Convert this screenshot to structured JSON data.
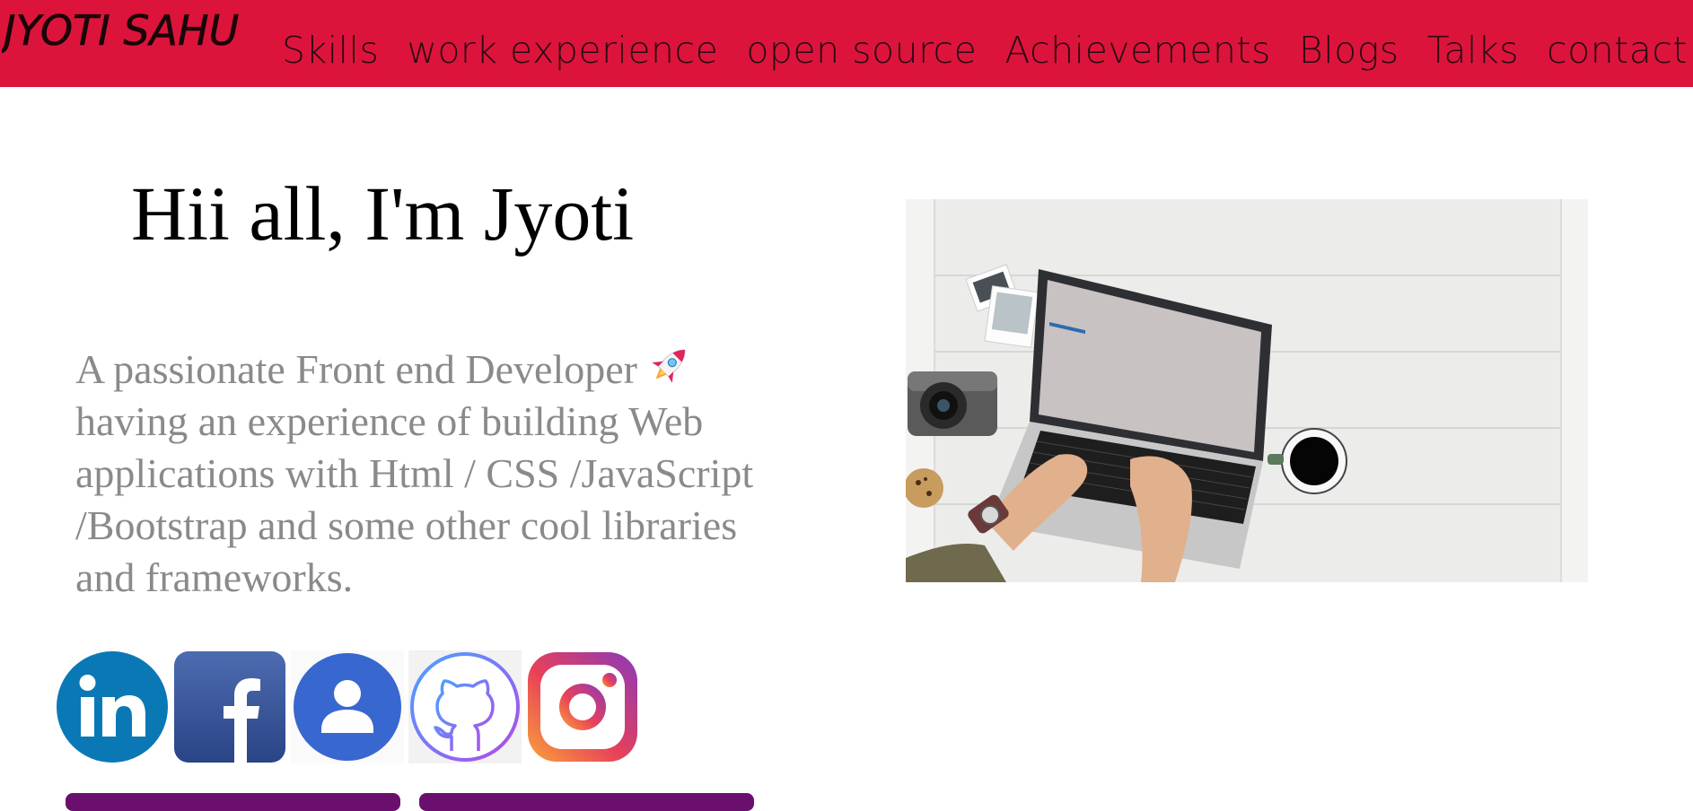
{
  "header": {
    "logo_text": "JYOTI SAHU",
    "brand_color": "#dc143c",
    "nav": [
      {
        "label": "Skills"
      },
      {
        "label": "work experience"
      },
      {
        "label": "open source"
      },
      {
        "label": "Achievements"
      },
      {
        "label": "Blogs"
      },
      {
        "label": "Talks"
      },
      {
        "label": "contact me"
      }
    ]
  },
  "hero": {
    "greeting": "Hii all, I'm Jyoti",
    "intro": "A passionate Front end Developer having an experience of building Web applications with Html / CSS /JavaScript /Bootstrap and some other cool libraries and frameworks.",
    "intro_lines": [
      "A passionate Front end Developer",
      "having an experience of building Web",
      "applications with Html / CSS /JavaScript",
      "/Bootstrap and some other cool libraries",
      "and frameworks."
    ],
    "emoji_icon": "rocket-icon",
    "image_icon": "laptop-desk-photo"
  },
  "social": [
    {
      "icon": "linkedin-icon"
    },
    {
      "icon": "facebook-icon"
    },
    {
      "icon": "profile-icon"
    },
    {
      "icon": "github-icon"
    },
    {
      "icon": "instagram-icon"
    }
  ],
  "colors": {
    "accent": "#dc143c",
    "text_muted": "#8a8a8a",
    "button": "#6b0f6e"
  }
}
